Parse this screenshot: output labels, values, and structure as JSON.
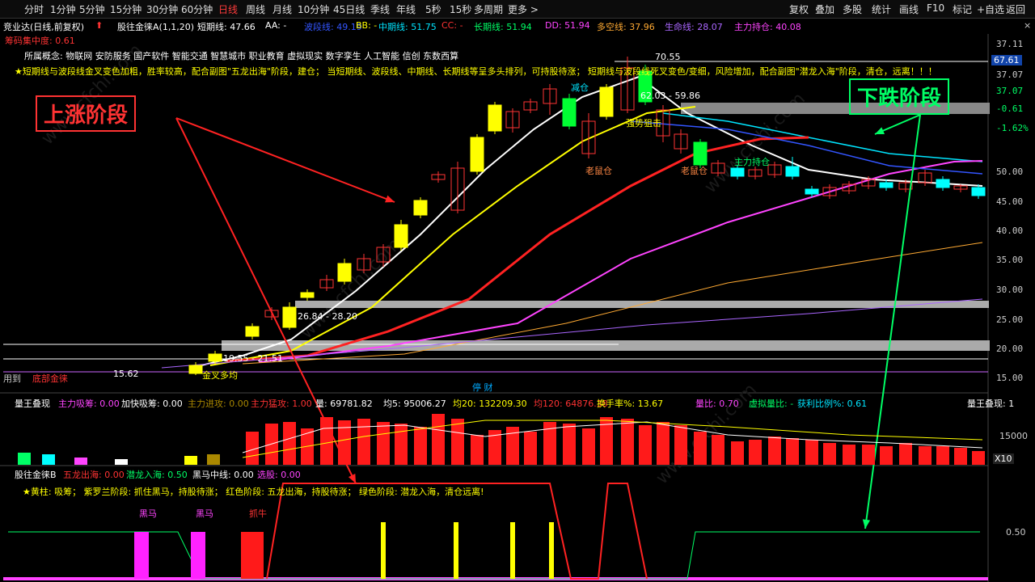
{
  "toolbar": {
    "left": [
      "分时",
      "1分钟",
      "5分钟",
      "15分钟",
      "30分钟",
      "60分钟",
      "日线",
      "周线",
      "月线",
      "10分钟",
      "45日线",
      "季线",
      "年线",
      "5秒",
      "15秒",
      "多周期",
      "更多 >"
    ],
    "active": "日线",
    "right": [
      "复权",
      "叠加",
      "多股",
      "统计",
      "画线",
      "F10",
      "标记",
      "+自选",
      "返回"
    ]
  },
  "legend": {
    "stock": "竞业达(日线,前复权)",
    "indicator": "股往金徕A(1,1,20)",
    "items": [
      {
        "label": "短期线: 47.66",
        "color": "#ffffff"
      },
      {
        "label": "AA: -",
        "color": "#ffffff"
      },
      {
        "label": "波段线: 49.19",
        "color": "#3355ff"
      },
      {
        "label": "BB: -",
        "color": "#ffff00"
      },
      {
        "label": "中期线: 51.75",
        "color": "#00e5ff"
      },
      {
        "label": "CC: -",
        "color": "#ff3333"
      },
      {
        "label": "长期线: 51.94",
        "color": "#00ff66"
      },
      {
        "label": "DD: 51.94",
        "color": "#ff44ff"
      },
      {
        "label": "多空线: 37.96",
        "color": "#ffaa33"
      },
      {
        "label": "生命线: 28.07",
        "color": "#aa66ff"
      },
      {
        "label": "主力持仓: 40.08",
        "color": "#ff44ff"
      }
    ],
    "chip": "筹码集中度: 0.61"
  },
  "concept": "所属概念: 物联网 安防服务 国产软件 智能交通 智慧城市 职业教育 虚拟现实 数字孪生 人工智能 信创 东数西算",
  "strategy": "★短期线与波段线金叉变色加粗，胜率较高，配合副图\"五龙出海\"阶段，建仓；  当短期线、波段线、中期线、长期线等呈多头排列，可持股待涨；  短期线与波段线死叉变色/变细，风险增加，配合副图\"潜龙入海\"阶段，清仓，远离！！！",
  "annotations": {
    "up_phase": "上涨阶段",
    "down_phase": "下跌阶段",
    "reduce": "减仓",
    "strong_hit": "强势狙击",
    "rat1": "老鼠仓",
    "rat2": "老鼠仓",
    "main_hold": "主力持仓",
    "peak": "70.55",
    "zone_top": "62.03 - 59.86",
    "zone_mid": "26.84 - 28.20",
    "zone_low": "19.55 - 21.51",
    "low_label": "15.62",
    "golden": "金叉多均",
    "bottom": "底部金徕",
    "used": "用到",
    "stock_type": "停 财",
    "latest": "67.61"
  },
  "price_axis": [
    "37.11",
    "37.07",
    "37.07",
    "-0.61",
    "-1.62%",
    "50.00",
    "45.00",
    "40.00",
    "35.00",
    "30.00",
    "25.00",
    "20.00",
    "15.00"
  ],
  "volume_panel": {
    "title": "量王叠现",
    "items": [
      {
        "label": "主力吸筹: 0.00",
        "color": "#ff44ff"
      },
      {
        "label": "加快吸筹: 0.00",
        "color": "#ffffff"
      },
      {
        "label": "主力进攻: 0.00",
        "color": "#aa8800"
      },
      {
        "label": "主力猛攻: 1.00",
        "color": "#ff3333"
      },
      {
        "label": "量: 69781.82",
        "color": "#ffffff"
      },
      {
        "label": "均5: 95006.27",
        "color": "#ffffff"
      },
      {
        "label": "均20: 132209.30",
        "color": "#ffff00"
      },
      {
        "label": "均120: 64876.38",
        "color": "#ff3333"
      },
      {
        "label": "换手率%: 13.67",
        "color": "#ffff00"
      },
      {
        "label": "量比: 0.70",
        "color": "#ff44ff"
      },
      {
        "label": "虚拟量比: -",
        "color": "#00ff66"
      },
      {
        "label": "获利比例%: 0.61",
        "color": "#00e5ff"
      }
    ],
    "tag": "量王叠现: 1",
    "axis": "15000",
    "unit": "X10"
  },
  "bottom_panel": {
    "title": "股往金徕B",
    "items": [
      {
        "label": "五龙出海: 0.00",
        "color": "#ff3333"
      },
      {
        "label": "潜龙入海: 0.50",
        "color": "#00ff66"
      },
      {
        "label": "黑马中线: 0.00",
        "color": "#ffffff"
      },
      {
        "label": "选股: 0.00",
        "color": "#ff44ff"
      }
    ],
    "legend": "★黄柱: 吸筹；   紫罗兰阶段: 抓住黑马，持股待涨；   红色阶段: 五龙出海，持股待涨；   绿色阶段: 潜龙入海，清仓远离!",
    "tags": [
      "黑马",
      "黑马",
      "抓牛"
    ],
    "axis": "0.50"
  },
  "colors": {
    "up": "#ff3333",
    "down": "#00ffff",
    "accent": "#ff3b3b"
  },
  "watermark": "www.cfchi.com"
}
